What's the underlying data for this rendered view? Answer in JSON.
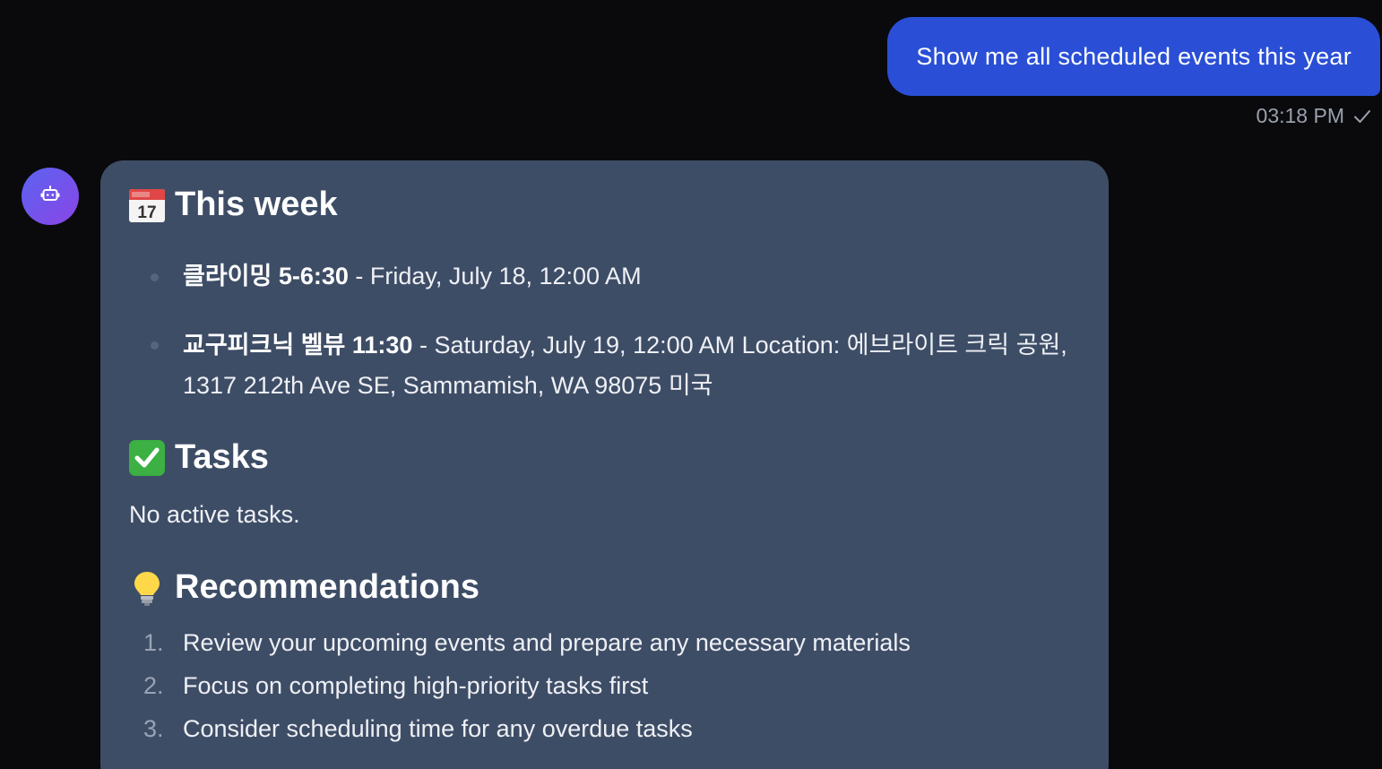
{
  "user_message": {
    "text": "Show me all scheduled events this year",
    "time": "03:18 PM",
    "status_icon": "check-icon"
  },
  "assistant": {
    "avatar_icon": "robot-icon",
    "avatar_gradient": [
      "#5b63f0",
      "#8a45e6"
    ],
    "sections": {
      "week": {
        "icon": "calendar-icon",
        "title": "This week",
        "events": [
          {
            "name": "클라이밍 5-6:30",
            "details": " - Friday, July 18, 12:00 AM"
          },
          {
            "name": "교구피크닉 벨뷰 11:30",
            "details": " - Saturday, July 19, 12:00 AM Location: 에브라이트 크릭 공원, 1317 212th Ave SE, Sammamish, WA 98075 미국"
          }
        ]
      },
      "tasks": {
        "icon": "checkmark-icon",
        "title": "Tasks",
        "text": "No active tasks."
      },
      "recommendations": {
        "icon": "lightbulb-icon",
        "title": "Recommendations",
        "items": [
          {
            "num": "1.",
            "text": "Review your upcoming events and prepare any necessary materials"
          },
          {
            "num": "2.",
            "text": "Focus on completing high-priority tasks first"
          },
          {
            "num": "3.",
            "text": "Consider scheduling time for any overdue tasks"
          }
        ]
      }
    }
  },
  "colors": {
    "background": "#0a0a0d",
    "user_bubble": "#2a4fd6",
    "card": "#3e4d66",
    "meta_text": "#9aa0ad"
  }
}
